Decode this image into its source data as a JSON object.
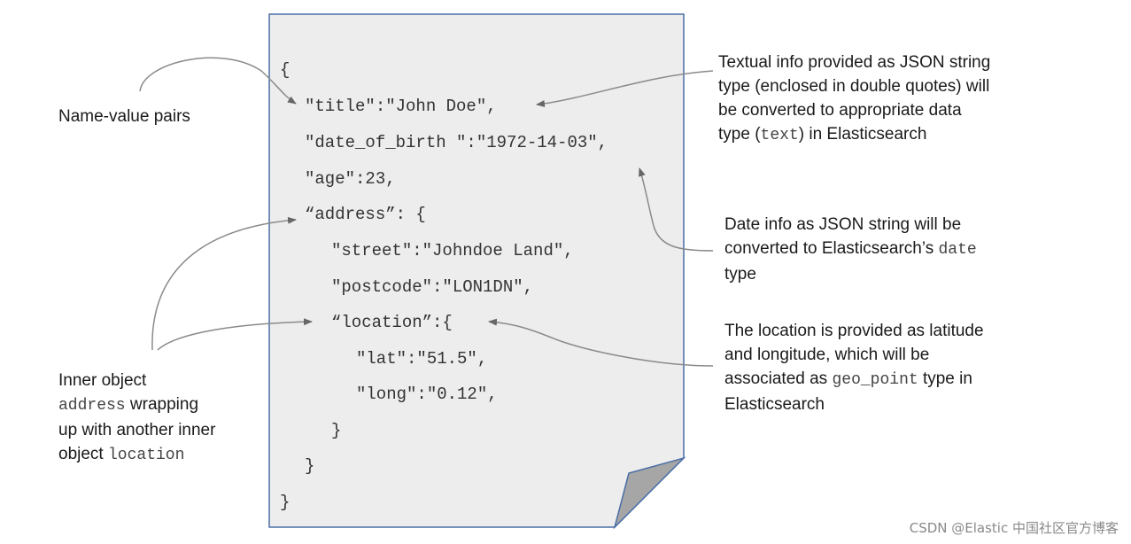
{
  "code": {
    "open_brace": "{",
    "title_line": "\"title\":\"John Doe\",",
    "dob_line": "\"date_of_birth \":\"1972-14-03\",",
    "age_line": "\"age\":23,",
    "address_line": "“address”: {",
    "street_line": "\"street\":\"Johndoe Land\",",
    "postcode_line": "\"postcode\":\"LON1DN\",",
    "location_line": "“location”:{",
    "lat_line": "\"lat\":\"51.5\",",
    "long_line": "\"long\":\"0.12\",",
    "inner_close": "}",
    "address_close": "}",
    "outer_close": "}"
  },
  "annotations": {
    "name_value": "Name-value pairs",
    "textual": {
      "l1": "Textual info provided as JSON string",
      "l2": "type (enclosed in double quotes) will",
      "l3": "be converted to appropriate data",
      "l4_pre": "type (",
      "l4_code": "text",
      "l4_post": ") in Elasticsearch"
    },
    "date": {
      "l1": "Date info as JSON string will be",
      "l2_pre": "converted to Elasticsearch’s ",
      "l2_code": "date",
      "l3": "type"
    },
    "location": {
      "l1": "The location is provided as latitude",
      "l2": "and longitude, which will be",
      "l3_pre": "associated as ",
      "l3_code": "geo_point",
      "l3_post": " type in",
      "l4": "Elasticsearch"
    },
    "inner": {
      "l1": "Inner object",
      "l2_code": "address",
      "l2_post": " wrapping",
      "l3": "up with another inner",
      "l4_pre": "object ",
      "l4_code": "location"
    }
  },
  "watermark": "CSDN @Elastic 中国社区官方博客",
  "colors": {
    "page_fill": "#ededed",
    "page_border": "#4a6fa5",
    "fold_fill": "#a6a6a6",
    "arrow": "#8a8a8a"
  }
}
